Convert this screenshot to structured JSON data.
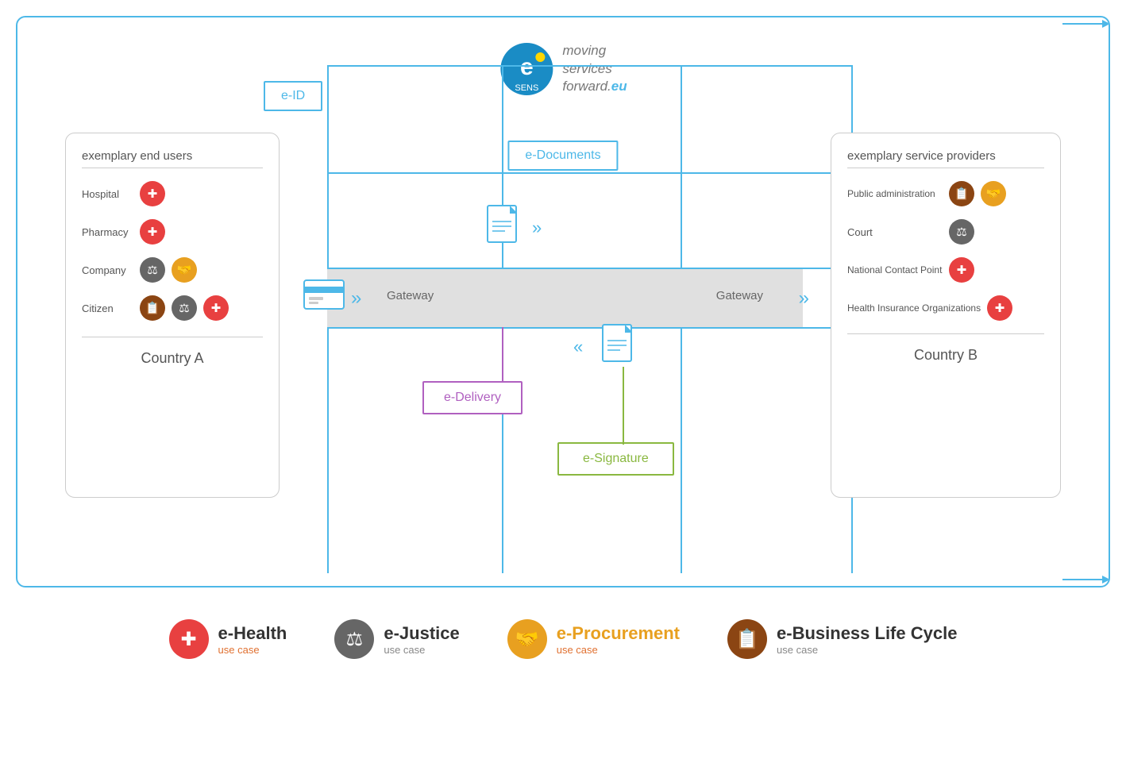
{
  "diagram": {
    "logo": {
      "text_line1": "moving",
      "text_line2": "services",
      "text_line3": "forward.",
      "text_eu": "eu",
      "sens_label": "SENS"
    },
    "e_id": "e-ID",
    "e_documents": "e-Documents",
    "e_delivery": "e-Delivery",
    "e_signature": "e-Signature",
    "gateway_left": "Gateway",
    "gateway_right": "Gateway",
    "left_panel": {
      "title": "exemplary end users",
      "entities": [
        {
          "label": "Hospital",
          "icons": [
            "health"
          ]
        },
        {
          "label": "Pharmacy",
          "icons": [
            "health"
          ]
        },
        {
          "label": "Company",
          "icons": [
            "justice",
            "procurement"
          ]
        },
        {
          "label": "Citizen",
          "icons": [
            "business",
            "justice",
            "health"
          ]
        }
      ],
      "country": "Country A"
    },
    "right_panel": {
      "title": "exemplary service providers",
      "entities": [
        {
          "label": "Public administration",
          "icons": [
            "business",
            "procurement"
          ]
        },
        {
          "label": "Court",
          "icons": [
            "justice"
          ]
        },
        {
          "label": "National Contact Point",
          "icons": [
            "health"
          ]
        },
        {
          "label": "Health Insurance Organizations",
          "icons": [
            "health"
          ]
        }
      ],
      "country": "Country B"
    }
  },
  "legend": [
    {
      "id": "ehealth",
      "title": "e-Health",
      "subtitle": "use case",
      "color": "#e84040",
      "icon": "health"
    },
    {
      "id": "ejustice",
      "title": "e-Justice",
      "subtitle": "use case",
      "subtitle_color": "gray",
      "color": "#666",
      "icon": "justice"
    },
    {
      "id": "eprocurement",
      "title": "e-Procurement",
      "subtitle": "use case",
      "color": "#e8a020",
      "icon": "procurement"
    },
    {
      "id": "ebusiness",
      "title": "e-Business Life Cycle",
      "subtitle": "use case",
      "subtitle_color": "gray",
      "color": "#8B4513",
      "icon": "business"
    }
  ]
}
